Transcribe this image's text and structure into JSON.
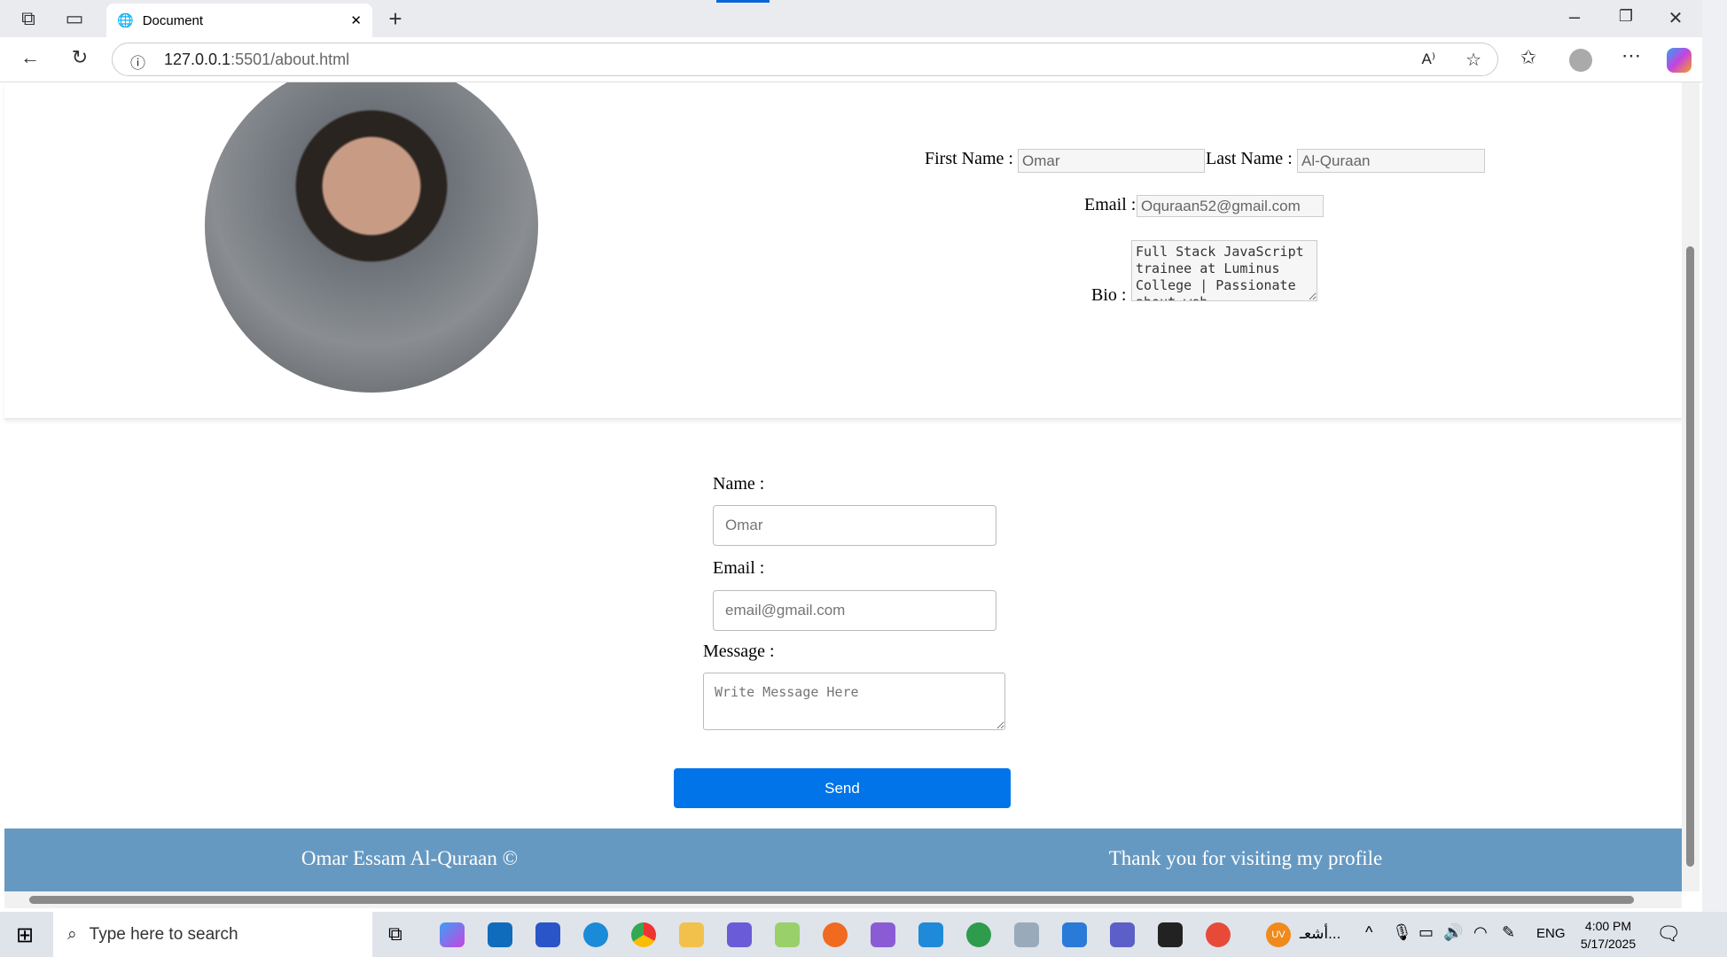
{
  "browser": {
    "tab_title": "Document",
    "url_host": "127.0.0.1",
    "url_path": ":5501/about.html"
  },
  "profile": {
    "first_name_label": "First Name :",
    "first_name": "Omar",
    "last_name_label": "Last Name :",
    "last_name": "Al-Quraan",
    "email_label": "Email :",
    "email": "Oquraan52@gmail.com",
    "bio_label": "Bio :",
    "bio": "Full Stack JavaScript trainee at Luminus College | Passionate about web"
  },
  "contact": {
    "name_label": "Name :",
    "name_placeholder": "Omar",
    "email_label": "Email :",
    "email_placeholder": "email@gmail.com",
    "message_label": "Message :",
    "message_placeholder": "Write Message Here",
    "send_label": "Send"
  },
  "footer": {
    "left": "Omar Essam Al-Quraan ©",
    "right": "Thank you for visiting my profile"
  },
  "taskbar": {
    "search_placeholder": "Type here to search",
    "avatar_initials": "UV",
    "notification_text": "أشعـ...",
    "language": "ENG",
    "time": "4:00 PM",
    "date": "5/17/2025"
  },
  "colors": {
    "send": "#0074e8",
    "footer": "#6699c2"
  }
}
